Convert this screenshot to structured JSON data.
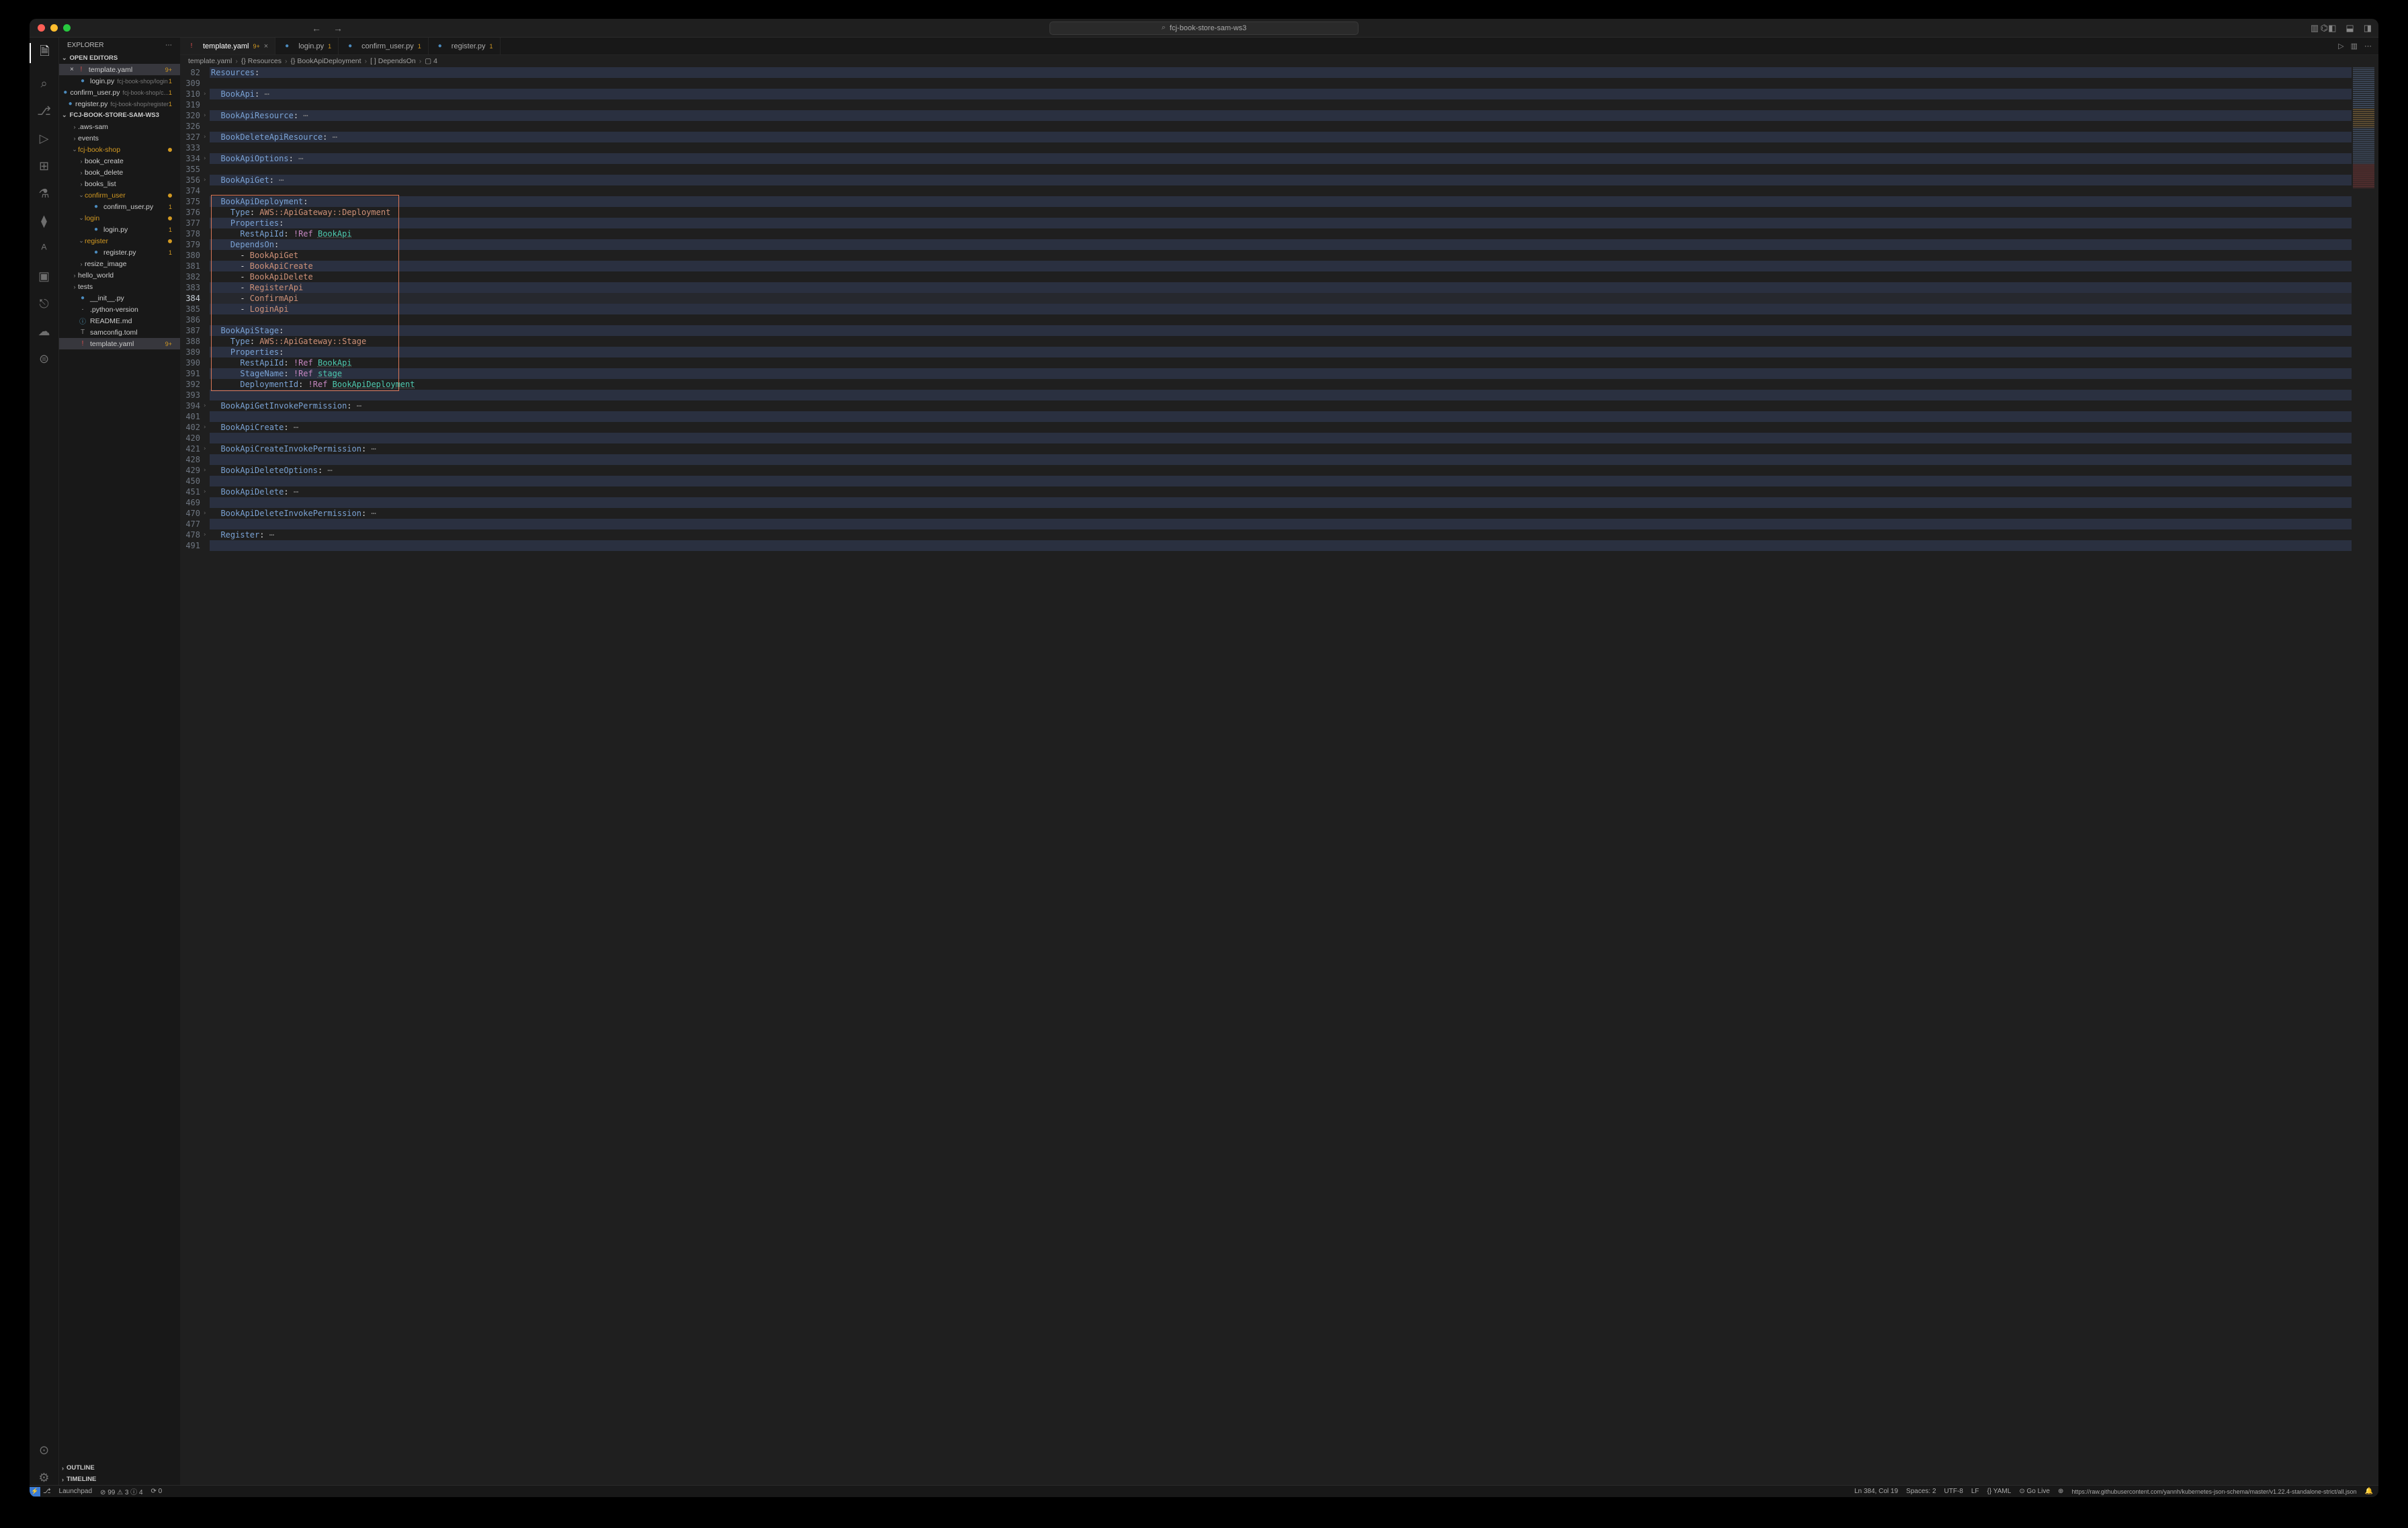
{
  "title": "fcj-book-store-sam-ws3",
  "tabs": [
    {
      "icon": "yaml",
      "label": "template.yaml",
      "badge": "9+",
      "active": true
    },
    {
      "icon": "py",
      "label": "login.py",
      "badge": "1"
    },
    {
      "icon": "py",
      "label": "confirm_user.py",
      "badge": "1"
    },
    {
      "icon": "py",
      "label": "register.py",
      "badge": "1"
    }
  ],
  "crumbs": [
    "template.yaml",
    "{} Resources",
    "{} BookApiDeployment",
    "[ ] DependsOn",
    "▢ 4"
  ],
  "explorer": {
    "title": "EXPLORER",
    "open": "OPEN EDITORS",
    "openItems": [
      {
        "icon": "yaml",
        "label": "template.yaml",
        "badge": "9+",
        "close": true,
        "sel": true
      },
      {
        "icon": "py",
        "label": "login.py",
        "dim": "fcj-book-shop/login",
        "badge": "1"
      },
      {
        "icon": "py",
        "label": "confirm_user.py",
        "dim": "fcj-book-shop/c...",
        "badge": "1"
      },
      {
        "icon": "py",
        "label": "register.py",
        "dim": "fcj-book-shop/register",
        "badge": "1"
      }
    ],
    "project": "FCJ-BOOK-STORE-SAM-WS3",
    "tree": [
      {
        "d": 1,
        "t": "fold",
        "chv": ">",
        "label": ".aws-sam"
      },
      {
        "d": 1,
        "t": "fold",
        "chv": ">",
        "label": "events"
      },
      {
        "d": 1,
        "t": "fold",
        "chv": "v",
        "label": "fcj-book-shop",
        "mod": true
      },
      {
        "d": 2,
        "t": "fold",
        "chv": ">",
        "label": "book_create"
      },
      {
        "d": 2,
        "t": "fold",
        "chv": ">",
        "label": "book_delete"
      },
      {
        "d": 2,
        "t": "fold",
        "chv": ">",
        "label": "books_list"
      },
      {
        "d": 2,
        "t": "fold",
        "chv": "v",
        "label": "confirm_user",
        "mod": true
      },
      {
        "d": 3,
        "t": "py",
        "label": "confirm_user.py",
        "badge": "1"
      },
      {
        "d": 2,
        "t": "fold",
        "chv": "v",
        "label": "login",
        "mod": true
      },
      {
        "d": 3,
        "t": "py",
        "label": "login.py",
        "badge": "1"
      },
      {
        "d": 2,
        "t": "fold",
        "chv": "v",
        "label": "register",
        "mod": true
      },
      {
        "d": 3,
        "t": "py",
        "label": "register.py",
        "badge": "1"
      },
      {
        "d": 2,
        "t": "fold",
        "chv": ">",
        "label": "resize_image"
      },
      {
        "d": 1,
        "t": "fold",
        "chv": ">",
        "label": "hello_world"
      },
      {
        "d": 1,
        "t": "fold",
        "chv": ">",
        "label": "tests"
      },
      {
        "d": 1,
        "t": "py",
        "label": "__init__.py"
      },
      {
        "d": 1,
        "t": "file",
        "label": ".python-version"
      },
      {
        "d": 1,
        "t": "md",
        "label": "README.md"
      },
      {
        "d": 1,
        "t": "toml",
        "label": "samconfig.toml"
      },
      {
        "d": 1,
        "t": "yaml",
        "label": "template.yaml",
        "badge": "9+",
        "sel": true
      }
    ],
    "outline": "OUTLINE",
    "timeline": "TIMELINE"
  },
  "code": {
    "lines": [
      {
        "n": 82,
        "hl": 1,
        "seg": [
          [
            "key",
            "Resources"
          ],
          [
            "pun",
            ":"
          ]
        ]
      },
      {
        "n": 309
      },
      {
        "n": 310,
        "hl": 1,
        "fold": 1,
        "seg": [
          [
            "pun",
            "  "
          ],
          [
            "key",
            "BookApi"
          ],
          [
            "pun",
            ":"
          ],
          [
            "elip",
            " ⋯"
          ]
        ]
      },
      {
        "n": 319
      },
      {
        "n": 320,
        "hl": 1,
        "fold": 1,
        "seg": [
          [
            "pun",
            "  "
          ],
          [
            "key",
            "BookApiResource"
          ],
          [
            "pun",
            ":"
          ],
          [
            "elip",
            " ⋯"
          ]
        ]
      },
      {
        "n": 326
      },
      {
        "n": 327,
        "hl": 1,
        "fold": 1,
        "seg": [
          [
            "pun",
            "  "
          ],
          [
            "key",
            "BookDeleteApiResource"
          ],
          [
            "pun",
            ":"
          ],
          [
            "elip",
            " ⋯"
          ]
        ]
      },
      {
        "n": 333
      },
      {
        "n": 334,
        "hl": 1,
        "fold": 1,
        "seg": [
          [
            "pun",
            "  "
          ],
          [
            "key",
            "BookApiOptions"
          ],
          [
            "pun",
            ":"
          ],
          [
            "elip",
            " ⋯"
          ]
        ]
      },
      {
        "n": 355
      },
      {
        "n": 356,
        "hl": 1,
        "fold": 1,
        "seg": [
          [
            "pun",
            "  "
          ],
          [
            "key",
            "BookApiGet"
          ],
          [
            "pun",
            ":"
          ],
          [
            "elip",
            " ⋯"
          ]
        ]
      },
      {
        "n": 374
      },
      {
        "n": 375,
        "hl": 1,
        "seg": [
          [
            "pun",
            "  "
          ],
          [
            "key",
            "BookApiDeployment"
          ],
          [
            "pun",
            ":"
          ]
        ]
      },
      {
        "n": 376,
        "seg": [
          [
            "pun",
            "    "
          ],
          [
            "key",
            "Type"
          ],
          [
            "pun",
            ": "
          ],
          [
            "str",
            "AWS::ApiGateway::Deployment"
          ]
        ]
      },
      {
        "n": 377,
        "hl": 1,
        "seg": [
          [
            "pun",
            "    "
          ],
          [
            "key",
            "Properties"
          ],
          [
            "pun",
            ":"
          ]
        ]
      },
      {
        "n": 378,
        "seg": [
          [
            "pun",
            "      "
          ],
          [
            "key",
            "RestApiId"
          ],
          [
            "pun",
            ": "
          ],
          [
            "tag",
            "!Ref"
          ],
          [
            "pun",
            " "
          ],
          [
            "ref",
            "BookApi"
          ]
        ]
      },
      {
        "n": 379,
        "hl": 1,
        "seg": [
          [
            "pun",
            "    "
          ],
          [
            "key",
            "DependsOn"
          ],
          [
            "pun",
            ":"
          ]
        ]
      },
      {
        "n": 380,
        "seg": [
          [
            "pun",
            "      - "
          ],
          [
            "str",
            "BookApiGet"
          ]
        ]
      },
      {
        "n": 381,
        "hl": 1,
        "seg": [
          [
            "pun",
            "      - "
          ],
          [
            "str",
            "BookApiCreate"
          ]
        ]
      },
      {
        "n": 382,
        "seg": [
          [
            "pun",
            "      - "
          ],
          [
            "str",
            "BookApiDelete"
          ]
        ]
      },
      {
        "n": 383,
        "hl": 1,
        "seg": [
          [
            "pun",
            "      - "
          ],
          [
            "str",
            "RegisterApi"
          ]
        ]
      },
      {
        "n": 384,
        "cur": 1,
        "seg": [
          [
            "pun",
            "      - "
          ],
          [
            "str",
            "ConfirmApi"
          ]
        ]
      },
      {
        "n": 385,
        "hl": 1,
        "seg": [
          [
            "pun",
            "      - "
          ],
          [
            "str",
            "LoginApi"
          ]
        ]
      },
      {
        "n": 386
      },
      {
        "n": 387,
        "hl": 1,
        "seg": [
          [
            "pun",
            "  "
          ],
          [
            "key",
            "BookApiStage"
          ],
          [
            "pun",
            ":"
          ]
        ]
      },
      {
        "n": 388,
        "seg": [
          [
            "pun",
            "    "
          ],
          [
            "key",
            "Type"
          ],
          [
            "pun",
            ": "
          ],
          [
            "str",
            "AWS::ApiGateway::Stage"
          ]
        ]
      },
      {
        "n": 389,
        "hl": 1,
        "seg": [
          [
            "pun",
            "    "
          ],
          [
            "key",
            "Properties"
          ],
          [
            "pun",
            ":"
          ]
        ]
      },
      {
        "n": 390,
        "seg": [
          [
            "pun",
            "      "
          ],
          [
            "key",
            "RestApiId"
          ],
          [
            "pun",
            ": "
          ],
          [
            "tag",
            "!Ref"
          ],
          [
            "pun",
            " "
          ],
          [
            "ref",
            "BookApi"
          ]
        ]
      },
      {
        "n": 391,
        "hl": 1,
        "seg": [
          [
            "pun",
            "      "
          ],
          [
            "key",
            "StageName"
          ],
          [
            "pun",
            ": "
          ],
          [
            "tag",
            "!Ref"
          ],
          [
            "pun",
            " "
          ],
          [
            "ref",
            "stage"
          ]
        ]
      },
      {
        "n": 392,
        "seg": [
          [
            "pun",
            "      "
          ],
          [
            "key",
            "DeploymentId"
          ],
          [
            "pun",
            ": "
          ],
          [
            "tag",
            "!Ref"
          ],
          [
            "pun",
            " "
          ],
          [
            "ref",
            "BookApiDeployment"
          ]
        ]
      },
      {
        "n": 393,
        "hl": 1
      },
      {
        "n": 394,
        "fold": 1,
        "seg": [
          [
            "pun",
            "  "
          ],
          [
            "key",
            "BookApiGetInvokePermission"
          ],
          [
            "pun",
            ":"
          ],
          [
            "elip",
            " ⋯"
          ]
        ]
      },
      {
        "n": 401,
        "hl": 1
      },
      {
        "n": 402,
        "fold": 1,
        "seg": [
          [
            "pun",
            "  "
          ],
          [
            "key",
            "BookApiCreate"
          ],
          [
            "pun",
            ":"
          ],
          [
            "elip",
            " ⋯"
          ]
        ]
      },
      {
        "n": 420,
        "hl": 1
      },
      {
        "n": 421,
        "fold": 1,
        "seg": [
          [
            "pun",
            "  "
          ],
          [
            "key",
            "BookApiCreateInvokePermission"
          ],
          [
            "pun",
            ":"
          ],
          [
            "elip",
            " ⋯"
          ]
        ]
      },
      {
        "n": 428,
        "hl": 1
      },
      {
        "n": 429,
        "fold": 1,
        "seg": [
          [
            "pun",
            "  "
          ],
          [
            "key",
            "BookApiDeleteOptions"
          ],
          [
            "pun",
            ":"
          ],
          [
            "elip",
            " ⋯"
          ]
        ]
      },
      {
        "n": 450,
        "hl": 1
      },
      {
        "n": 451,
        "fold": 1,
        "seg": [
          [
            "pun",
            "  "
          ],
          [
            "key",
            "BookApiDelete"
          ],
          [
            "pun",
            ":"
          ],
          [
            "elip",
            " ⋯"
          ]
        ]
      },
      {
        "n": 469,
        "hl": 1
      },
      {
        "n": 470,
        "fold": 1,
        "seg": [
          [
            "pun",
            "  "
          ],
          [
            "key",
            "BookApiDeleteInvokePermission"
          ],
          [
            "pun",
            ":"
          ],
          [
            "elip",
            " ⋯"
          ]
        ]
      },
      {
        "n": 477,
        "hl": 1
      },
      {
        "n": 478,
        "fold": 1,
        "seg": [
          [
            "pun",
            "  "
          ],
          [
            "key",
            "Register"
          ],
          [
            "pun",
            ":"
          ],
          [
            "elip",
            " ⋯"
          ]
        ]
      },
      {
        "n": 491,
        "hl": 1
      }
    ]
  },
  "status": {
    "launchpad": "Launchpad",
    "problems": "⊘ 99 ⚠ 3 ⓘ 4",
    "ports": "⟳ 0",
    "pos": "Ln 384, Col 19",
    "spaces": "Spaces: 2",
    "enc": "UTF-8",
    "eol": "LF",
    "lang": "{} YAML",
    "golive": "⊙ Go Live",
    "schema": "https://raw.githubusercontent.com/yannh/kubernetes-json-schema/master/v1.22.4-standalone-strict/all.json"
  }
}
